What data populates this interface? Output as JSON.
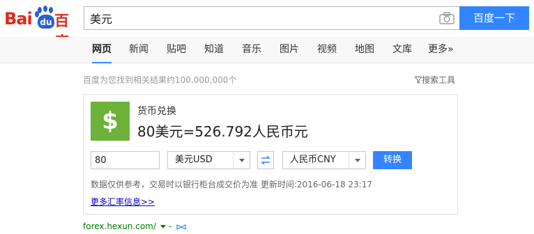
{
  "logo": {
    "bai": "Bai",
    "du": "du",
    "baidu_cn": "百度"
  },
  "search": {
    "query": "美元",
    "button_label": "百度一下"
  },
  "nav": {
    "items": [
      {
        "label": "网页",
        "active": true
      },
      {
        "label": "新闻"
      },
      {
        "label": "贴吧"
      },
      {
        "label": "知道"
      },
      {
        "label": "音乐"
      },
      {
        "label": "图片"
      },
      {
        "label": "视频"
      },
      {
        "label": "地图"
      },
      {
        "label": "文库"
      },
      {
        "label": "更多»"
      }
    ]
  },
  "results": {
    "count_text": "百度为您找到相关结果约100,000,000个",
    "tools_label": "搜索工具"
  },
  "card": {
    "icon_symbol": "$",
    "title": "货币兑换",
    "result": "80美元=526.792人民币元",
    "amount": "80",
    "from_currency": "美元USD",
    "to_currency": "人民币CNY",
    "convert_label": "转换",
    "disclaimer": "数据仅供参考，交易时以银行柜台成交价为准 更新时间:2016-06-18 23:17",
    "more_link": "更多汇率信息>>",
    "accent_color": "#6db23a"
  },
  "source": {
    "url": "forex.hexun.com/",
    "sep": "-"
  },
  "colors": {
    "brand_red": "#de2a1e",
    "brand_blue": "#3385ff",
    "link": "#00c",
    "url_green": "#008000"
  }
}
